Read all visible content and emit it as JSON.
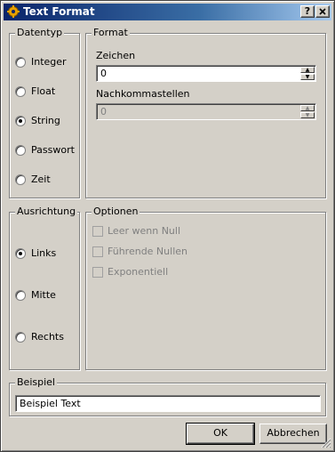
{
  "window": {
    "title": "Text Format",
    "help_button": "?",
    "close_button": "X"
  },
  "datentyp": {
    "legend": "Datentyp",
    "options": [
      {
        "label": "Integer",
        "selected": false
      },
      {
        "label": "Float",
        "selected": false
      },
      {
        "label": "String",
        "selected": true
      },
      {
        "label": "Passwort",
        "selected": false
      },
      {
        "label": "Zeit",
        "selected": false
      }
    ]
  },
  "format": {
    "legend": "Format",
    "zeichen_label": "Zeichen",
    "zeichen_value": "0",
    "nachkommastellen_label": "Nachkommastellen",
    "nachkommastellen_value": "0",
    "nachkommastellen_enabled": false
  },
  "ausrichtung": {
    "legend": "Ausrichtung",
    "options": [
      {
        "label": "Links",
        "selected": true
      },
      {
        "label": "Mitte",
        "selected": false
      },
      {
        "label": "Rechts",
        "selected": false
      }
    ]
  },
  "optionen": {
    "legend": "Optionen",
    "checkboxes": [
      {
        "label": "Leer wenn Null",
        "checked": false,
        "enabled": false
      },
      {
        "label": "Führende Nullen",
        "checked": false,
        "enabled": false
      },
      {
        "label": "Exponentiell",
        "checked": false,
        "enabled": false
      }
    ]
  },
  "beispiel": {
    "legend": "Beispiel",
    "value": "Beispiel Text"
  },
  "buttons": {
    "ok": "OK",
    "cancel": "Abbrechen"
  },
  "colors": {
    "face": "#d4d0c8",
    "title_start": "#0a246a",
    "title_end": "#a6caf0",
    "disabled_text": "#808080"
  }
}
